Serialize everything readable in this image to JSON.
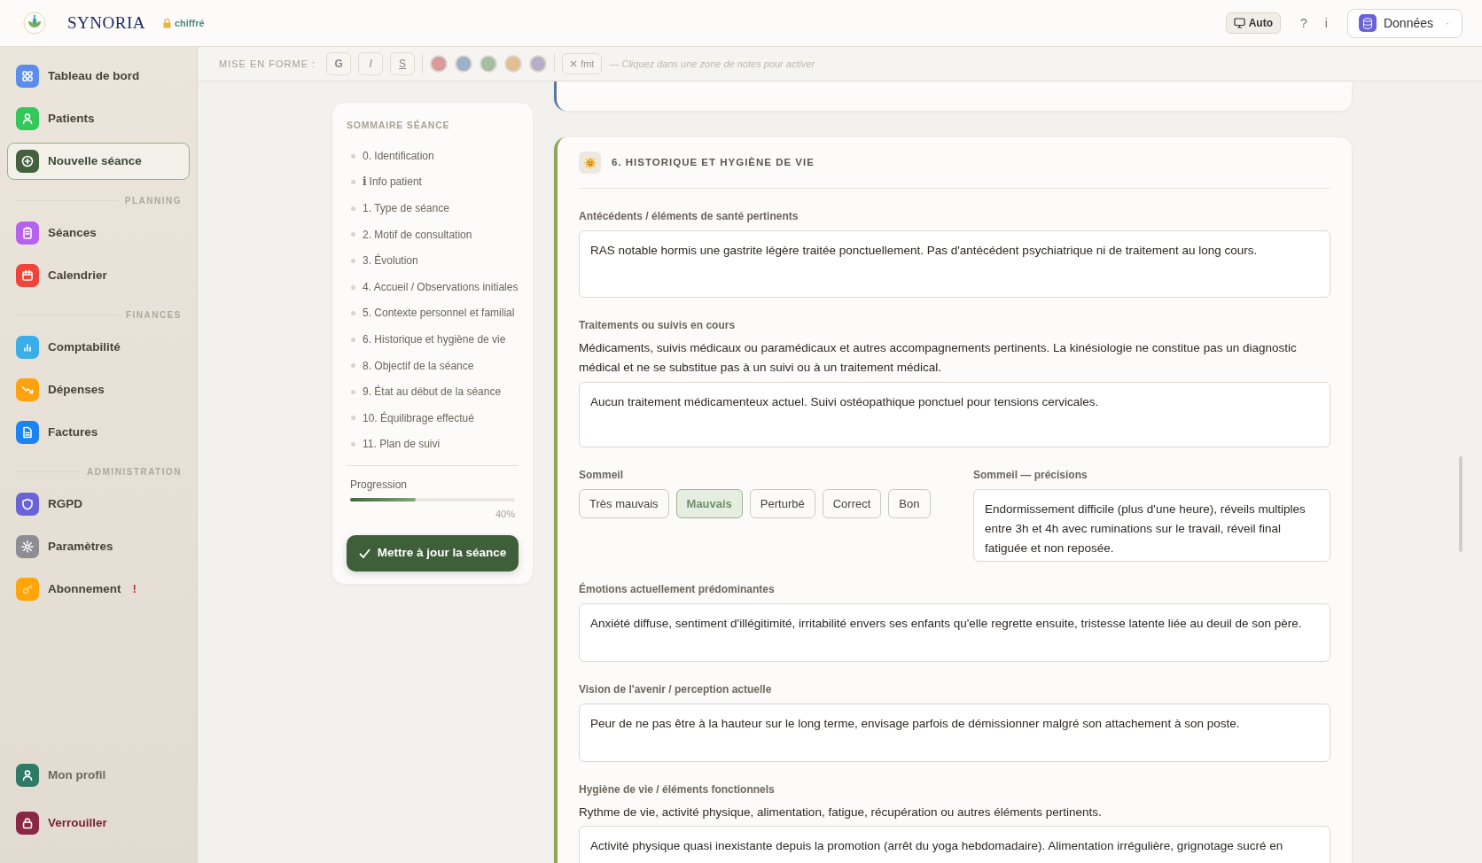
{
  "topbar": {
    "brand": "SYNORIA",
    "security": "chiffré",
    "theme_button": "Auto",
    "help": "?",
    "info": "i",
    "data_menu": "Données",
    "data_caret": "·"
  },
  "sidebar": {
    "groups": [
      {
        "items": [
          {
            "label": "Tableau de bord",
            "color": "#5b8def",
            "selected": false
          },
          {
            "label": "Patients",
            "color": "#34c759",
            "selected": false
          },
          {
            "label": "Nouvelle séance",
            "color": "#44603f",
            "selected": true
          }
        ]
      },
      {
        "heading": "PLANNING",
        "items": [
          {
            "label": "Séances",
            "color": "#b562f0",
            "selected": false
          },
          {
            "label": "Calendrier",
            "color": "#f0443a",
            "selected": false
          }
        ]
      },
      {
        "heading": "FINANCES",
        "items": [
          {
            "label": "Comptabilité",
            "color": "#3aaee8",
            "selected": false
          },
          {
            "label": "Dépenses",
            "color": "#ffa20f",
            "selected": false
          },
          {
            "label": "Factures",
            "color": "#1a84f5",
            "selected": false
          }
        ]
      },
      {
        "heading": "ADMINISTRATION",
        "items": [
          {
            "label": "RGPD",
            "color": "#6a63d8",
            "selected": false
          },
          {
            "label": "Paramètres",
            "color": "#8e8d93",
            "selected": false
          },
          {
            "label": "Abonnement",
            "alert": "!",
            "color": "#ffa50a",
            "selected": false
          }
        ]
      }
    ],
    "footer": [
      {
        "label": "Mon profil",
        "color": "#2e7a66",
        "danger": false
      },
      {
        "label": "Verrouiller",
        "color": "#8a2746",
        "danger": true
      }
    ]
  },
  "toolbar": {
    "label": "MISE EN FORME :",
    "format_buttons": [
      "G",
      "I",
      "S"
    ],
    "swatches": [
      {
        "color": "#d89a9a"
      },
      {
        "color": "#9fb0c8"
      },
      {
        "color": "#a3bf9f"
      },
      {
        "color": "#e2bf95"
      },
      {
        "color": "#b8aec8"
      }
    ],
    "clear_button": "fmt",
    "hint": "— Cliquez dans une zone de notes pour activer"
  },
  "summary": {
    "title": "SOMMAIRE SÉANCE",
    "items": [
      {
        "label": "0. Identification"
      },
      {
        "glyph": "i",
        "label": "Info patient"
      },
      {
        "label": "1. Type de séance"
      },
      {
        "label": "2. Motif de consultation"
      },
      {
        "label": "3. Évolution"
      },
      {
        "label": "4. Accueil / Observations initiales"
      },
      {
        "label": "5. Contexte personnel et familial"
      },
      {
        "label": "6. Historique et hygiène de vie"
      },
      {
        "label": "8. Objectif de la séance"
      },
      {
        "label": "9. État au début de la séance"
      },
      {
        "label": "10. Équilibrage effectué"
      },
      {
        "label": "11. Plan de suivi"
      }
    ],
    "progress": {
      "label": "Progression",
      "level": 0.4,
      "reading": "40%"
    },
    "save_button": "Mettre à jour la séance"
  },
  "section": {
    "title": "6. HISTORIQUE ET HYGIÈNE DE VIE",
    "fields": [
      {
        "kind": "textarea",
        "label": "Antécédents / éléments de santé pertinents",
        "value": "RAS notable hormis une gastrite légère traitée ponctuellement. Pas d'antécédent psychiatrique ni de traitement au long cours."
      },
      {
        "kind": "textarea",
        "label": "Traitements ou suivis en cours",
        "help": "Médicaments, suivis médicaux ou paramédicaux et autres accompagnements pertinents. La kinésiologie ne constitue pas un diagnostic médical et ne se substitue pas à un suivi ou à un traitement médical.",
        "value": "Aucun traitement médicamenteux actuel. Suivi ostéopathique ponctuel pour tensions cervicales."
      },
      {
        "kind": "choice",
        "label": "Sommeil",
        "options": [
          {
            "label": "Très mauvais",
            "selected": false
          },
          {
            "label": "Mauvais",
            "selected": true
          },
          {
            "label": "Perturbé",
            "selected": false
          },
          {
            "label": "Correct",
            "selected": false
          },
          {
            "label": "Bon",
            "selected": false
          }
        ],
        "detail_label": "Sommeil — précisions",
        "detail_value": "Endormissement difficile (plus d'une heure), réveils multiples entre 3h et 4h avec ruminations sur le travail, réveil final fatiguée et non reposée."
      },
      {
        "kind": "textarea",
        "label": "Émotions actuellement prédominantes",
        "value": "Anxiété diffuse, sentiment d'illégitimité, irritabilité envers ses enfants qu'elle regrette ensuite, tristesse latente liée au deuil de son père."
      },
      {
        "kind": "textarea",
        "label": "Vision de l'avenir / perception actuelle",
        "value": "Peur de ne pas être à la hauteur sur le long terme, envisage parfois de démissionner malgré son attachement à son poste."
      },
      {
        "kind": "textarea",
        "label": "Hygiène de vie / éléments fonctionnels",
        "help": "Rythme de vie, activité physique, alimentation, fatigue, récupération ou autres éléments pertinents.",
        "value": "Activité physique quasi inexistante depuis la promotion (arrêt du yoga hebdomadaire). Alimentation irrégulière, grignotage sucré en"
      }
    ]
  }
}
